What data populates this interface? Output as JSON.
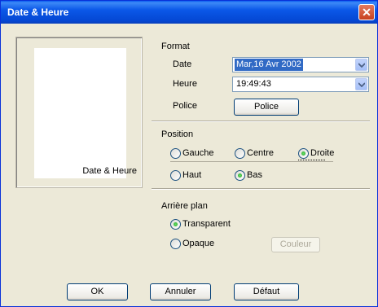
{
  "window": {
    "title": "Date & Heure",
    "close_glyph": "✕"
  },
  "preview": {
    "text": "Date & Heure"
  },
  "format": {
    "section_label": "Format",
    "date_label": "Date",
    "date_value": "Mar,16 Avr 2002",
    "time_label": "Heure",
    "time_value": "19:49:43",
    "font_label": "Police",
    "font_button": "Police"
  },
  "position": {
    "section_label": "Position",
    "horizontal": [
      {
        "label": "Gauche",
        "selected": false
      },
      {
        "label": "Centre",
        "selected": false
      },
      {
        "label": "Droite",
        "selected": true
      }
    ],
    "vertical": [
      {
        "label": "Haut",
        "selected": false
      },
      {
        "label": "Bas",
        "selected": true
      }
    ]
  },
  "background": {
    "section_label": "Arrière plan",
    "transparent_label": "Transparent",
    "transparent_selected": true,
    "opaque_label": "Opaque",
    "opaque_selected": false,
    "color_button": "Couleur"
  },
  "footer": {
    "ok": "OK",
    "cancel": "Annuler",
    "default": "Défaut"
  },
  "colors": {
    "titlebar": "#0a5bf0",
    "dialog_bg": "#ece9d8",
    "selection": "#316ac5",
    "radio_on": "#21a121"
  },
  "icons": {
    "combo_arrow": "chevron-down-icon",
    "close": "close-icon"
  }
}
